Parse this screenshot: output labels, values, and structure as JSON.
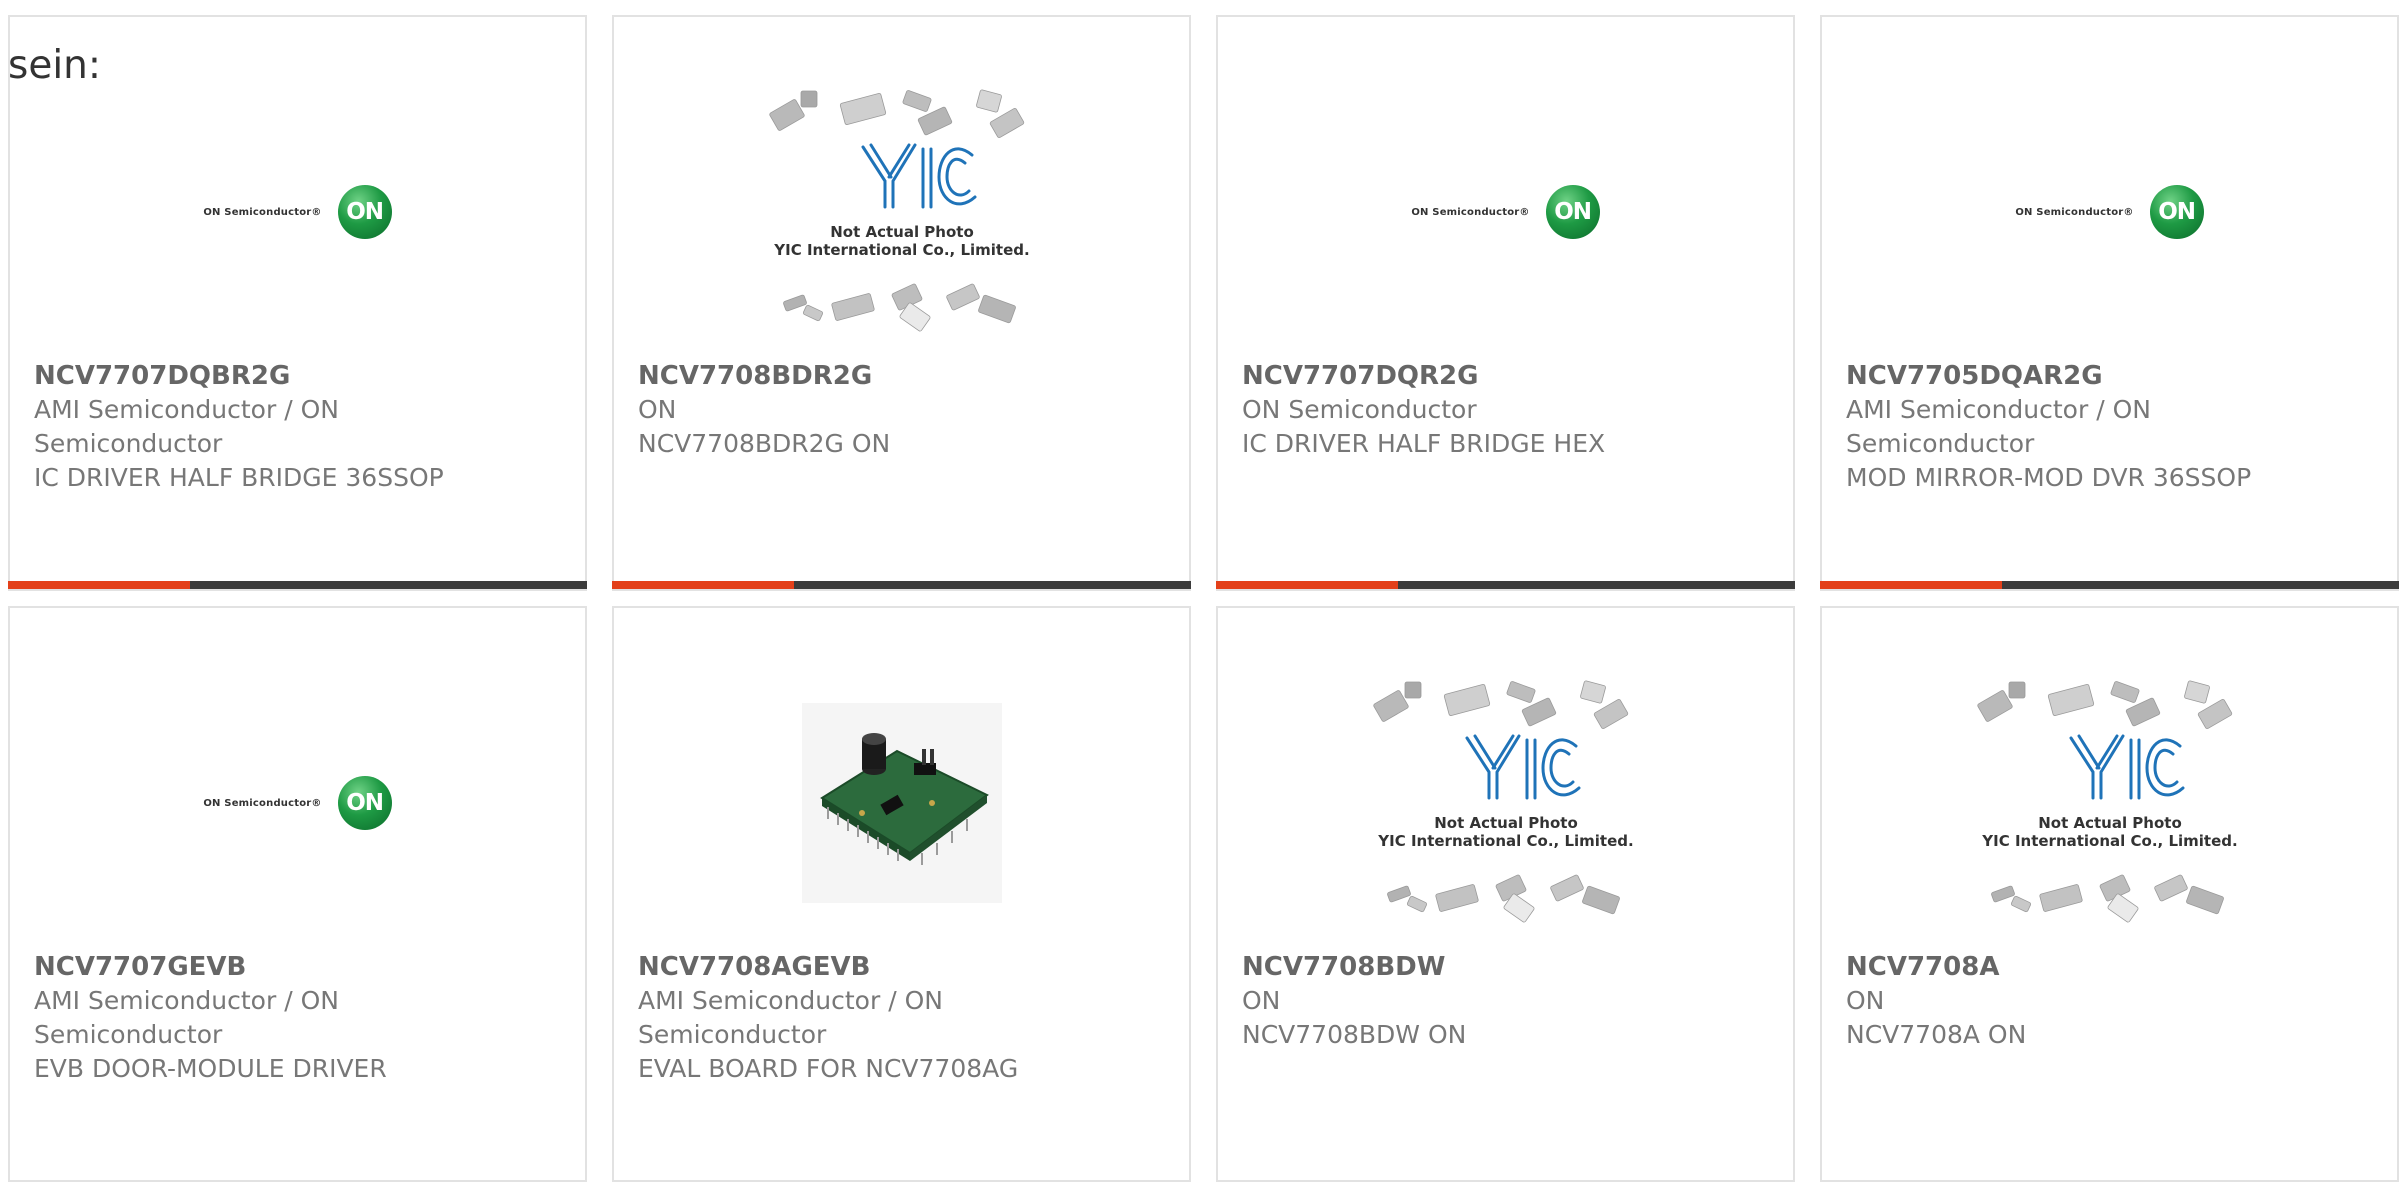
{
  "lead_text": "sein:",
  "colors": {
    "accent": "#e3401a",
    "bar": "#3b3b3b",
    "border": "#e2e2e2"
  },
  "cards": [
    {
      "image": "on-semiconductor-logo",
      "part": "NCV7707DQBR2G",
      "lines": [
        "AMI Semiconductor / ON",
        "Semiconductor",
        "IC DRIVER HALF BRIDGE 36SSOP"
      ]
    },
    {
      "image": "yic-placeholder",
      "part": "NCV7708BDR2G",
      "lines": [
        "ON",
        "NCV7708BDR2G ON"
      ]
    },
    {
      "image": "on-semiconductor-logo",
      "part": "NCV7707DQR2G",
      "lines": [
        "ON Semiconductor",
        "IC DRIVER HALF BRIDGE HEX"
      ]
    },
    {
      "image": "on-semiconductor-logo",
      "part": "NCV7705DQAR2G",
      "lines": [
        "AMI Semiconductor / ON",
        "Semiconductor",
        "MOD MIRROR-MOD DVR 36SSOP"
      ]
    },
    {
      "image": "on-semiconductor-logo",
      "part": "NCV7707GEVB",
      "lines": [
        "AMI Semiconductor / ON",
        "Semiconductor",
        "EVB DOOR-MODULE DRIVER"
      ]
    },
    {
      "image": "eval-board-photo",
      "part": "NCV7708AGEVB",
      "lines": [
        "AMI Semiconductor / ON",
        "Semiconductor",
        "EVAL BOARD FOR NCV7708AG"
      ]
    },
    {
      "image": "yic-placeholder",
      "part": "NCV7708BDW",
      "lines": [
        "ON",
        "NCV7708BDW ON"
      ]
    },
    {
      "image": "yic-placeholder",
      "part": "NCV7708A",
      "lines": [
        "ON",
        "NCV7708A ON"
      ]
    }
  ],
  "logos": {
    "on_text": "ON Semiconductor®",
    "on_mark": "ON",
    "yic_caption_1": "Not Actual Photo",
    "yic_caption_2": "YIC International Co., Limited."
  }
}
